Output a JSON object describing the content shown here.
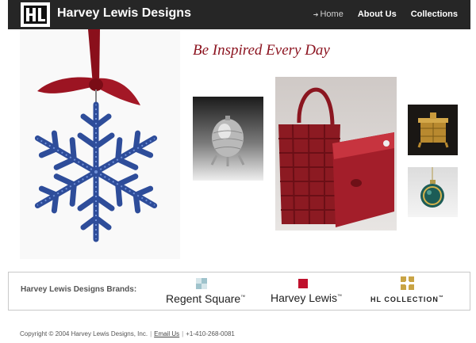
{
  "header": {
    "brand_name": "Harvey Lewis Designs",
    "nav": [
      {
        "label": "Home",
        "active": true
      },
      {
        "label": "About Us",
        "active": false
      },
      {
        "label": "Collections",
        "active": false
      }
    ]
  },
  "main": {
    "tagline": "Be Inspired Every Day"
  },
  "brands": {
    "label": "Harvey Lewis Designs Brands:",
    "items": [
      {
        "name": "Regent Square",
        "trademark": "™"
      },
      {
        "name": "Harvey Lewis",
        "trademark": "™"
      },
      {
        "name": "HL COLLECTION",
        "trademark": "™"
      }
    ]
  },
  "footer": {
    "copyright": "Copyright © 2004 Harvey Lewis Designs, Inc.",
    "email_link": "Email Us",
    "phone": "+1-410-268-0081"
  },
  "colors": {
    "header_bg": "#262626",
    "tagline": "#8c1420",
    "accent_red": "#c0112d",
    "gold": "#c9a445"
  }
}
